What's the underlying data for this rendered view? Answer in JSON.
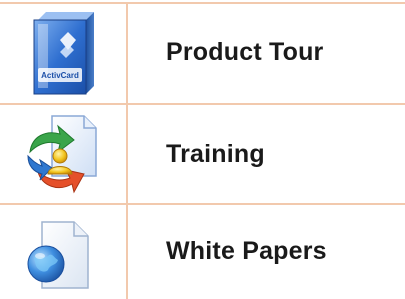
{
  "menu": {
    "items": [
      {
        "label": "Product Tour",
        "icon": "software-box-icon",
        "box_text": "ActivCard"
      },
      {
        "label": "Training",
        "icon": "training-document-icon"
      },
      {
        "label": "White Papers",
        "icon": "globe-document-icon"
      }
    ]
  },
  "colors": {
    "grid_line": "#f2c9ad",
    "label_text": "#1a1a1a",
    "background": "#ffffff"
  }
}
